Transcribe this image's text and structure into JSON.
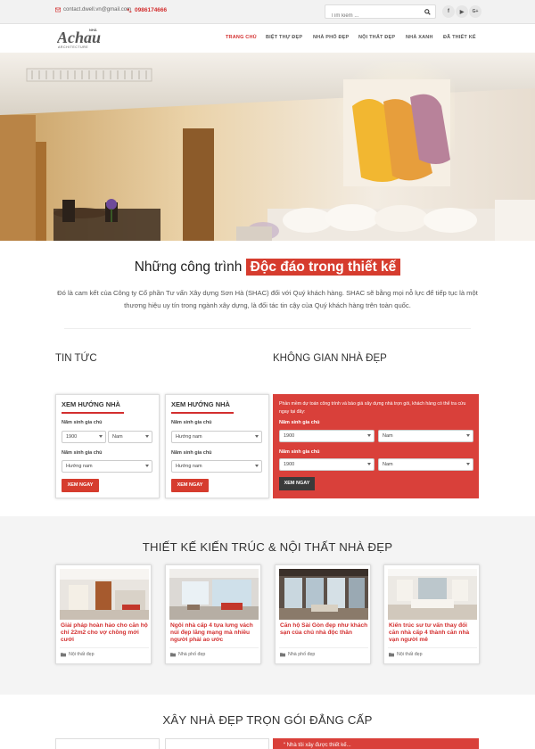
{
  "topbar": {
    "email": "contact.dwell.vn@gmail.com",
    "phone": "0986174666",
    "search_placeholder": "Tìm kiếm ...",
    "social": [
      "f",
      "▶",
      "G+"
    ]
  },
  "nav": {
    "logo_text": "Achau",
    "logo_sub": "ARCHITECTURE",
    "logo_tag": "NHÀ",
    "items": [
      "TRANG CHỦ",
      "BIỆT THỰ ĐẸP",
      "NHÀ PHỐ ĐẸP",
      "NỘI THẤT ĐẸP",
      "NHÀ XANH",
      "ĐÃ THIẾT KẾ"
    ],
    "active_index": 0
  },
  "intro": {
    "title_plain": "Những công trình",
    "title_highlight": "Độc đáo trong thiết kế",
    "text": "Đó là cam kết của Công ty Cổ phần Tư vấn Xây dựng Sơn Hà (SHAC) đối với Quý khách hàng. SHAC sẽ bằng mọi nỗ lực để tiếp tục là một thương hiệu uy tín trong ngành xây dựng, là đối tác tin cậy của Quý khách hàng trên toàn quốc."
  },
  "sections": {
    "news": "TIN TỨC",
    "space": "KHÔNG GIAN NHÀ ĐẸP"
  },
  "widget": {
    "title": "XEM HƯỚNG NHÀ",
    "label_year": "Năm sinh gia chủ",
    "year_value": "1900",
    "gender_value": "Nam",
    "label_dir": "Năm sinh gia chủ",
    "dir_value": "Hướng nam",
    "button": "XEM NGAY"
  },
  "redbox": {
    "text": "Phần mềm dự toán công trình và báo giá xây dựng nhà trọn gói, khách hàng có thể tra cứu ngay tại đây:",
    "label1": "Năm sinh gia chủ",
    "year1": "1900",
    "gender1": "Nam",
    "label2": "Năm sinh gia chủ",
    "year2": "1900",
    "gender2": "Nam",
    "button": "XEM NGAY"
  },
  "architecture": {
    "title": "THIẾT KẾ KIẾN TRÚC & NỘI THẤT NHÀ ĐẸP",
    "cards": [
      {
        "title": "Giải pháp hoàn hảo cho căn hộ chỉ 22m2 cho vợ chồng mới cưới",
        "category": "Nội thất đẹp"
      },
      {
        "title": "Ngôi nhà cấp 4 tựa lưng vách núi đẹp lãng mạng mà nhiều người phải ao ước",
        "category": "Nhà phố đẹp"
      },
      {
        "title": "Căn hộ Sài Gòn đẹp như khách sạn của chủ nhà độc thân",
        "category": "Nhà phố đẹp"
      },
      {
        "title": "Kiến trúc sư tư vấn thay đổi căn nhà cấp 4 thành căn nhà vạn người mê",
        "category": "Nội thất đẹp"
      }
    ]
  },
  "bottom": {
    "title": "XÂY NHÀ ĐẸP TRỌN GÓI ĐẲNG CẤP",
    "quote_snippet": "“ Nhà tôi xây được thiết kế..."
  },
  "colors": {
    "accent": "#d63c2e",
    "dark": "#3a3a3a"
  }
}
